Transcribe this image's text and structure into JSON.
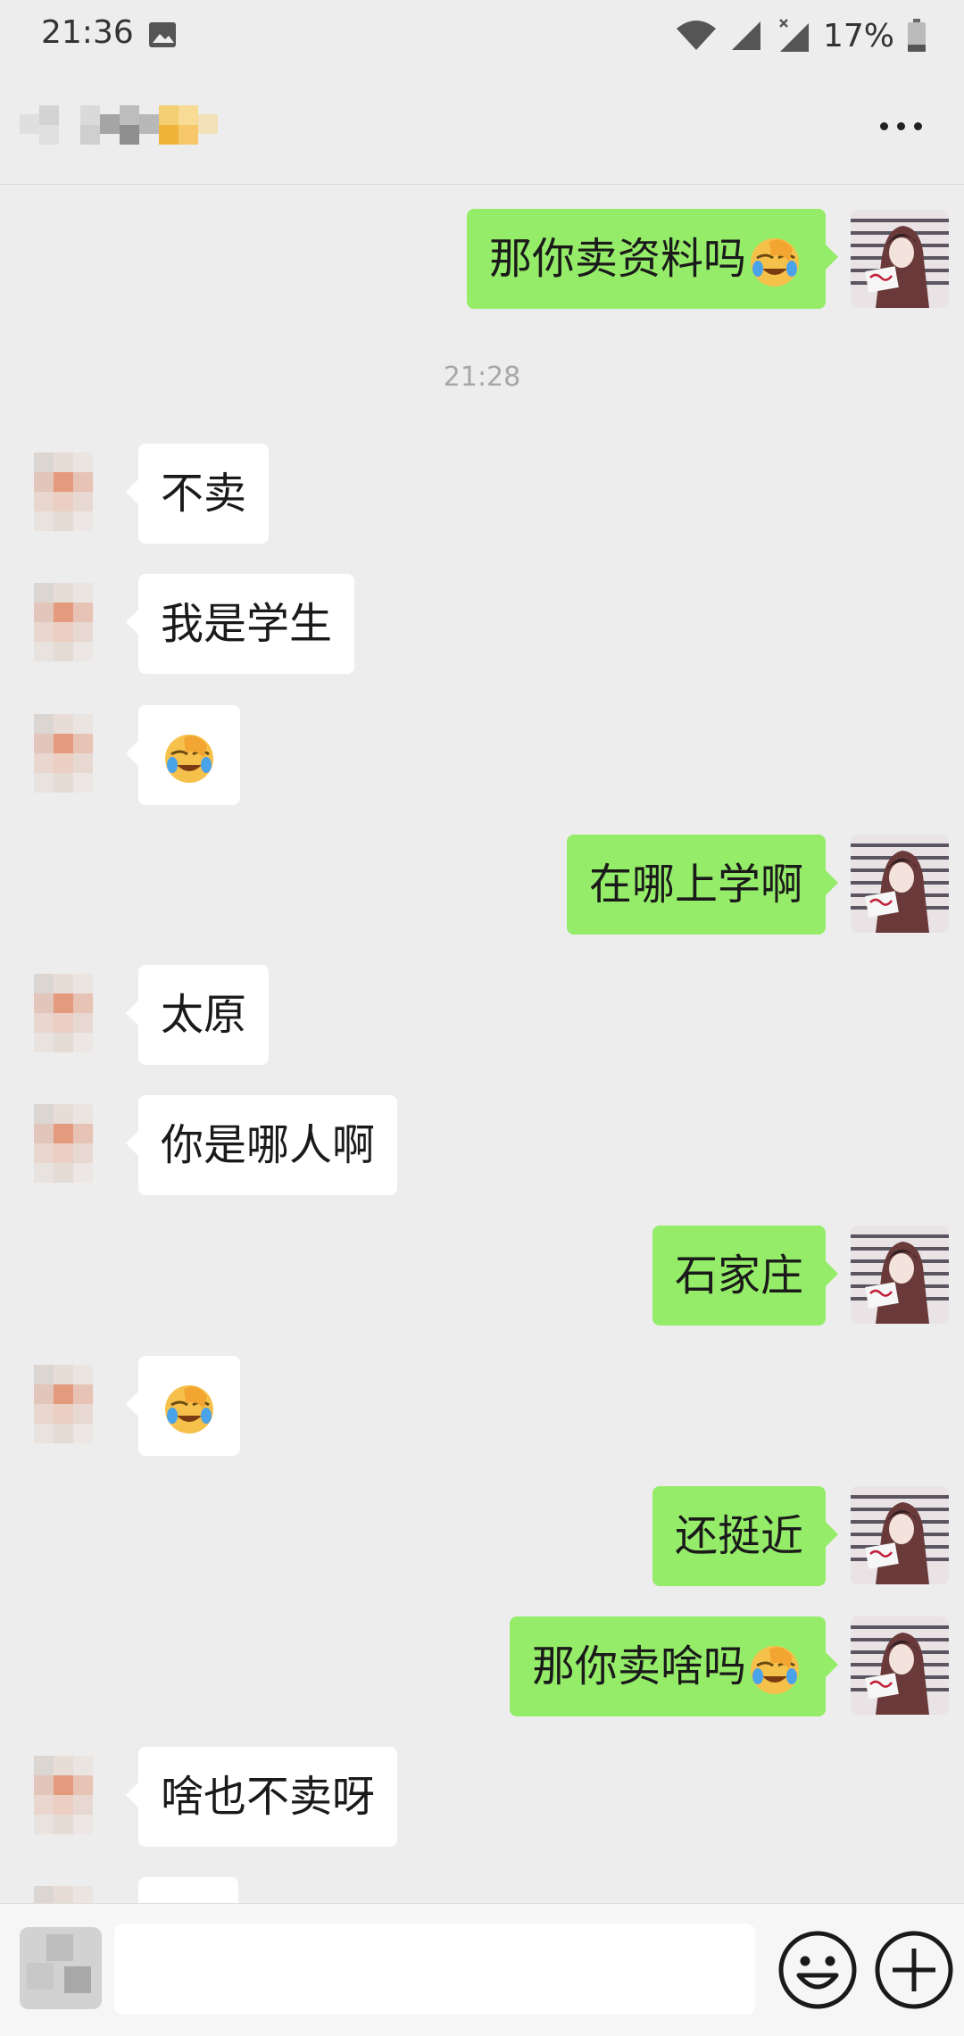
{
  "status_bar": {
    "time": "21:36",
    "battery_percent": "17%",
    "icons": [
      "image-icon",
      "wifi-icon",
      "signal-icon",
      "signal-no-sim-icon",
      "battery-icon"
    ]
  },
  "header": {
    "contact_name": "",
    "more_icon": "more-dots-icon"
  },
  "chat": {
    "timestamp": "21:28",
    "messages": [
      {
        "from": "self",
        "text": "那你卖资料吗",
        "emoji": "facepalm-laugh-emoji"
      },
      {
        "from": "other",
        "text": "不卖"
      },
      {
        "from": "other",
        "text": "我是学生"
      },
      {
        "from": "other",
        "text": "",
        "emoji": "facepalm-laugh-emoji"
      },
      {
        "from": "self",
        "text": "在哪上学啊"
      },
      {
        "from": "other",
        "text": "太原"
      },
      {
        "from": "other",
        "text": "你是哪人啊"
      },
      {
        "from": "self",
        "text": "石家庄"
      },
      {
        "from": "other",
        "text": "",
        "emoji": "facepalm-laugh-emoji"
      },
      {
        "from": "self",
        "text": "还挺近"
      },
      {
        "from": "self",
        "text": "那你卖啥吗",
        "emoji": "facepalm-laugh-emoji"
      },
      {
        "from": "other",
        "text": "啥也不卖呀"
      }
    ]
  },
  "input_bar": {
    "value": "",
    "icons": [
      "voice-icon",
      "emoji-icon",
      "plus-icon"
    ]
  },
  "colors": {
    "background": "#ededed",
    "outgoing_bubble": "#95ec69",
    "incoming_bubble": "#ffffff",
    "timestamp_text": "#a7a7a7"
  }
}
